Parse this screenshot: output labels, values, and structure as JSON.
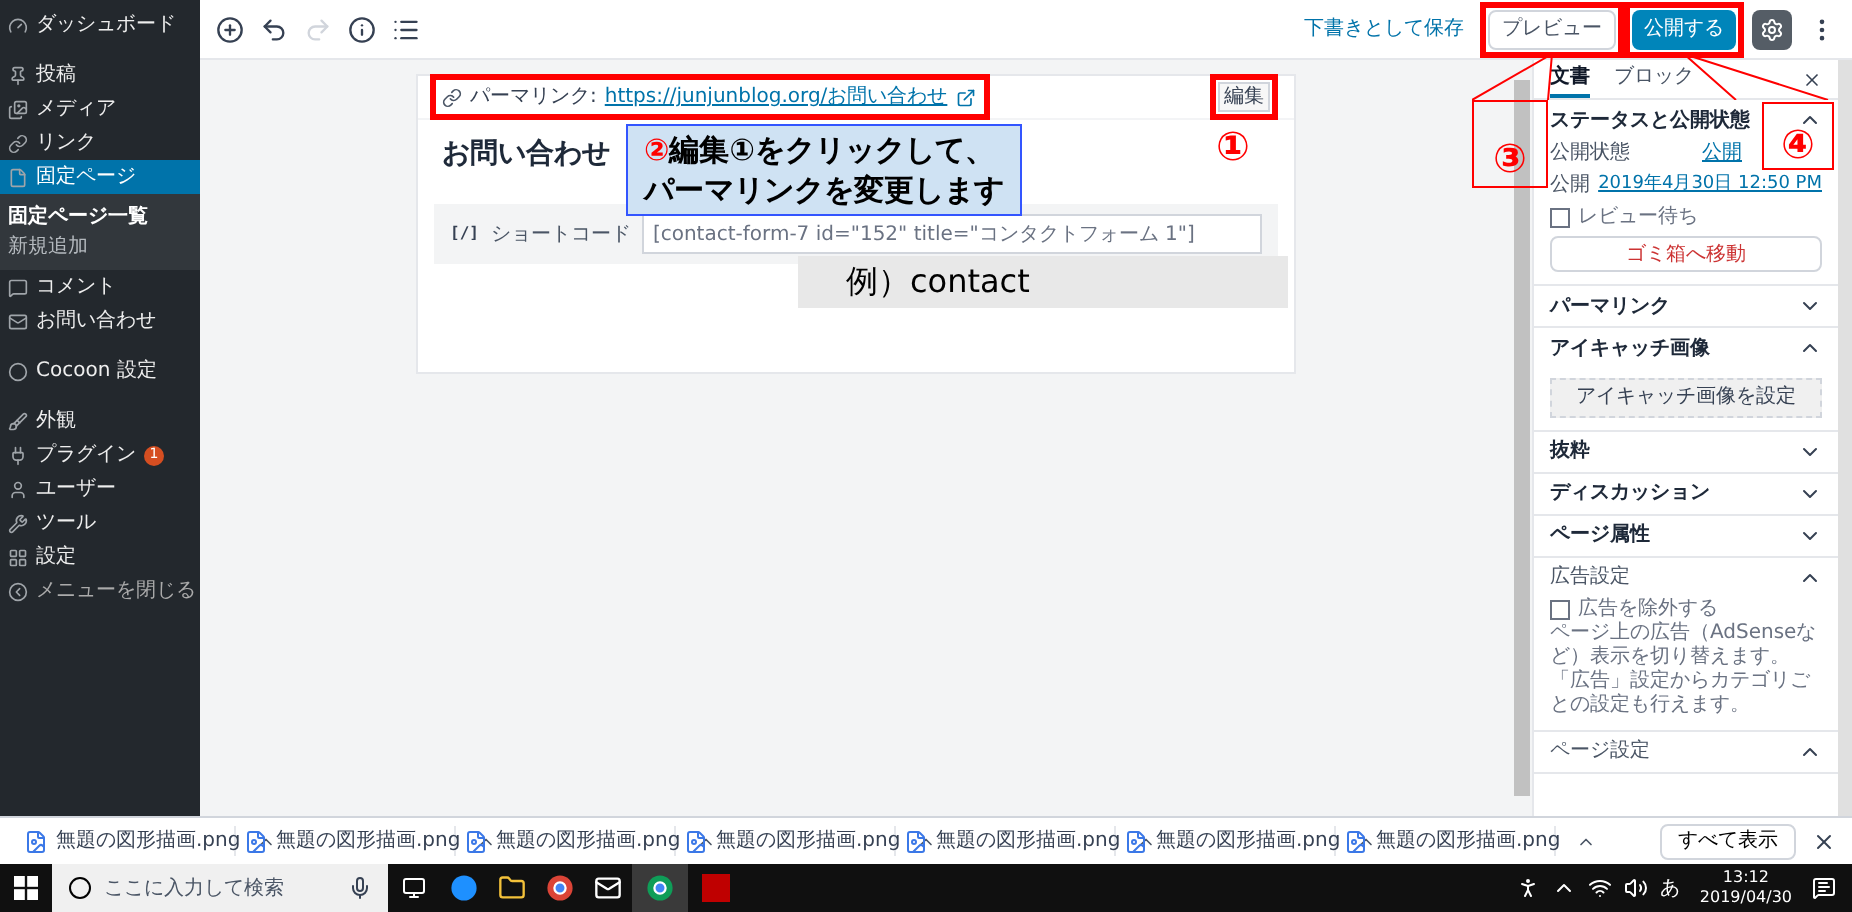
{
  "sidebar": {
    "items": [
      {
        "label": "ダッシュボード",
        "selected": false
      },
      {
        "label": "投稿",
        "selected": false
      },
      {
        "label": "メディア",
        "selected": false
      },
      {
        "label": "リンク",
        "selected": false
      },
      {
        "label": "固定ページ",
        "selected": true,
        "children": [
          {
            "label": "固定ページ一覧",
            "selected": true
          },
          {
            "label": "新規追加",
            "selected": false
          }
        ]
      },
      {
        "label": "コメント",
        "selected": false
      },
      {
        "label": "お問い合わせ",
        "selected": false
      },
      {
        "label": "Cocoon 設定",
        "selected": false
      },
      {
        "label": "外観",
        "selected": false
      },
      {
        "label": "プラグイン",
        "selected": false,
        "badge": "1"
      },
      {
        "label": "ユーザー",
        "selected": false
      },
      {
        "label": "ツール",
        "selected": false
      },
      {
        "label": "設定",
        "selected": false
      },
      {
        "label": "メニューを閉じる",
        "selected": false
      }
    ]
  },
  "toolbar": {
    "save_draft": "下書きとして保存",
    "preview": "プレビュー",
    "publish": "公開する"
  },
  "editor": {
    "permalink_label": "パーマリンク:",
    "permalink_url": "https://junjunblog.org/お問い合わせ",
    "edit_button": "編集",
    "title": "お問い合わせ",
    "block": {
      "icon_text": "[/]",
      "label": "ショートコード",
      "value": "[contact-form-7 id=\"152\" title=\"コンタクトフォーム 1\"]"
    }
  },
  "settings_panel": {
    "tabs": [
      {
        "label": "文書",
        "selected": true
      },
      {
        "label": "ブロック",
        "selected": false
      }
    ],
    "sections": [
      {
        "kind": "status",
        "title": "ステータスと公開状態",
        "expanded": true,
        "visibility_label": "公開状態",
        "visibility_value": "公開",
        "publish_label": "公開",
        "publish_date": "2019年4月30日 12:50 PM",
        "pending_label": "レビュー待ち",
        "pending_checked": false,
        "trash_button": "ゴミ箱へ移動"
      },
      {
        "kind": "plain",
        "title": "パーマリンク",
        "expanded": false
      },
      {
        "kind": "featured_image",
        "title": "アイキャッチ画像",
        "expanded": true,
        "button": "アイキャッチ画像を設定"
      },
      {
        "kind": "plain",
        "title": "抜粋",
        "expanded": false
      },
      {
        "kind": "plain",
        "title": "ディスカッション",
        "expanded": false
      },
      {
        "kind": "plain",
        "title": "ページ属性",
        "expanded": false
      },
      {
        "kind": "ad",
        "title": "広告設定",
        "expanded": true,
        "checkbox_label": "広告を除外する",
        "checked": false,
        "description": "ページ上の広告（AdSenseなど）表示を切り替えます。「広告」設定からカテゴリごとの設定も行えます。"
      },
      {
        "kind": "plain",
        "title": "ページ設定",
        "expanded": true
      }
    ]
  },
  "annotations": {
    "callout": {
      "number": "②",
      "lines": [
        "編集①をクリックして、",
        "パーマリンクを変更します"
      ]
    },
    "example": "例）contact",
    "markers": [
      "①",
      "③",
      "④"
    ]
  },
  "downloads": {
    "files": [
      "無題の図形描画.png",
      "無題の図形描画.png",
      "無題の図形描画.png",
      "無題の図形描画.png",
      "無題の図形描画.png",
      "無題の図形描画.png",
      "無題の図形描画.png"
    ],
    "show_all": "すべて表示"
  },
  "taskbar": {
    "search_placeholder": "ここに入力して検索",
    "ime": "あ",
    "time": "13:12",
    "date": "2019/04/30"
  }
}
